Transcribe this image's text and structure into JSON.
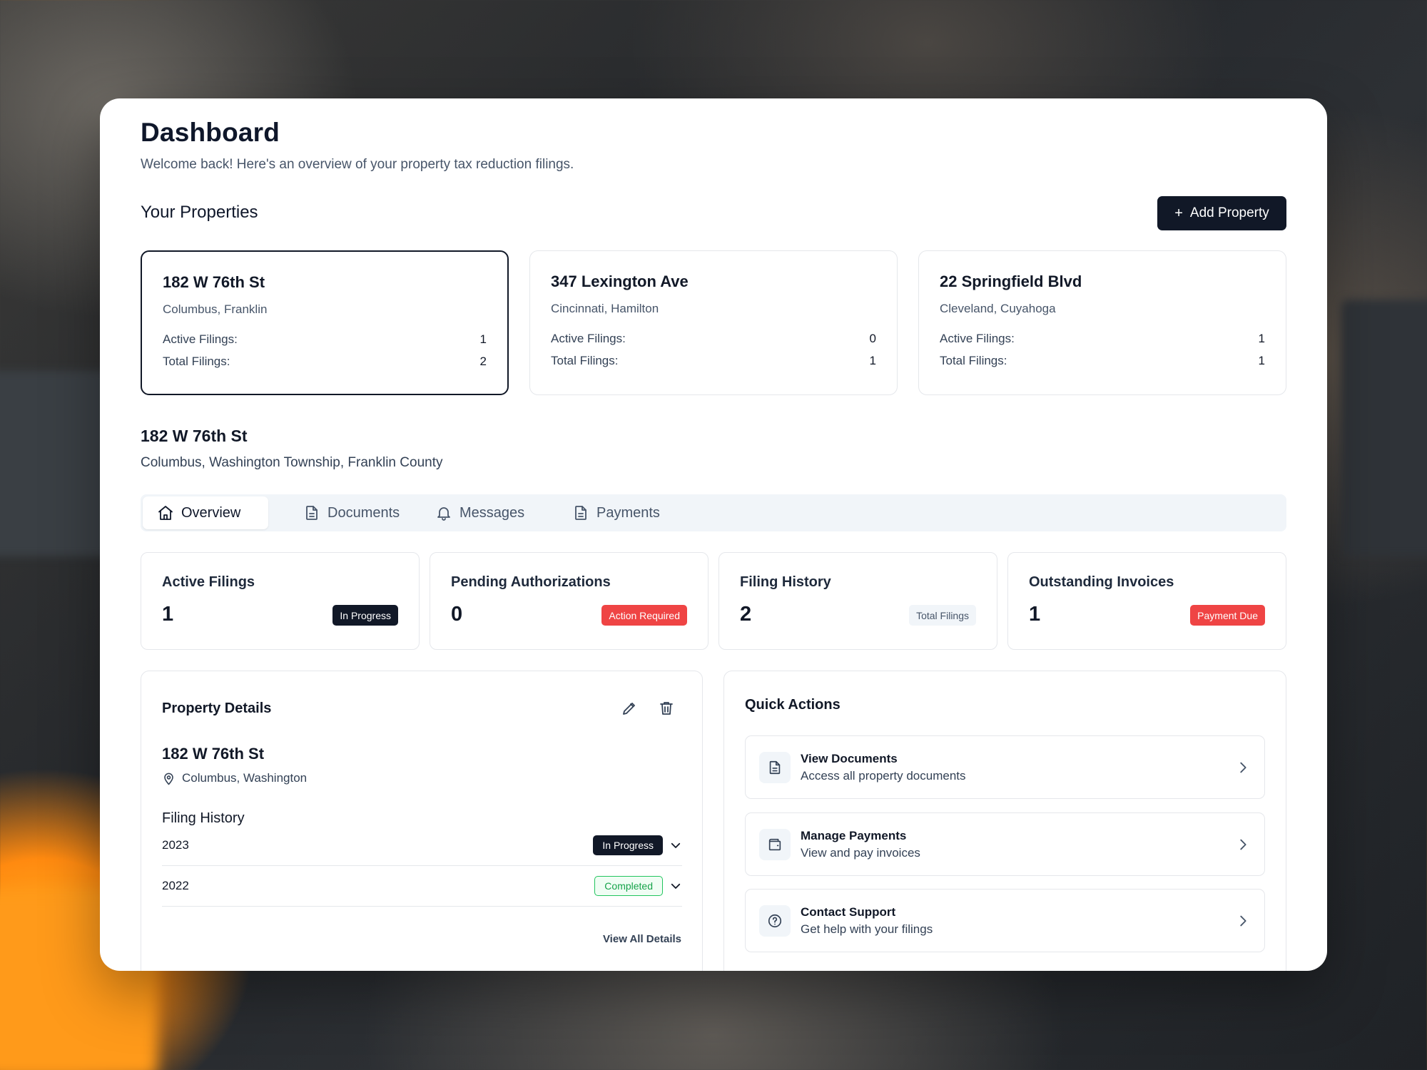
{
  "page": {
    "title": "Dashboard",
    "subtitle": "Welcome back! Here's an overview of your property tax reduction filings."
  },
  "properties_section": {
    "title": "Your Properties",
    "add_button": {
      "icon": "plus-icon",
      "label": "Add Property"
    }
  },
  "property_cards": [
    {
      "address": "182 W 76th St",
      "location": "Columbus, Franklin",
      "active_label": "Active Filings:",
      "active_value": "1",
      "total_label": "Total Filings:",
      "total_value": "2",
      "selected": true
    },
    {
      "address": "347 Lexington Ave",
      "location": "Cincinnati, Hamilton",
      "active_label": "Active Filings:",
      "active_value": "0",
      "total_label": "Total Filings:",
      "total_value": "1",
      "selected": false
    },
    {
      "address": "22 Springfield Blvd",
      "location": "Cleveland, Cuyahoga",
      "active_label": "Active Filings:",
      "active_value": "1",
      "total_label": "Total Filings:",
      "total_value": "1",
      "selected": false
    }
  ],
  "selected_property": {
    "address": "182 W 76th St",
    "location": "Columbus, Washington Township, Franklin County"
  },
  "tabs": [
    {
      "label": "Overview",
      "icon": "home-icon",
      "active": true
    },
    {
      "label": "Documents",
      "icon": "document-icon",
      "active": false
    },
    {
      "label": "Messages",
      "icon": "bell-icon",
      "active": false
    },
    {
      "label": "Payments",
      "icon": "document-icon",
      "active": false
    }
  ],
  "stats": [
    {
      "title": "Active Filings",
      "value": "1",
      "badge": "In Progress",
      "badge_color": "#111827"
    },
    {
      "title": "Pending Authorizations",
      "value": "0",
      "badge": "Action Required",
      "badge_color": "#ef4444"
    },
    {
      "title": "Filing History",
      "value": "2",
      "badge": "Total Filings",
      "badge_color": "#f1f5f9"
    },
    {
      "title": "Outstanding Invoices",
      "value": "1",
      "badge": "Payment Due",
      "badge_color": "#ef4444"
    }
  ],
  "property_details": {
    "title": "Property Details",
    "edit_icon": "pencil-icon",
    "delete_icon": "trash-icon",
    "address": "182 W 76th St",
    "location": "Columbus, Washington",
    "location_icon": "map-pin-icon",
    "filing_history_title": "Filing History",
    "filings": [
      {
        "year": "2023",
        "status": "In Progress",
        "status_color": "#111827"
      },
      {
        "year": "2022",
        "status": "Completed",
        "status_color": "#16a34a"
      }
    ],
    "view_all": "View All Details"
  },
  "quick_actions": {
    "title": "Quick Actions",
    "items": [
      {
        "name": "View Documents",
        "description": "Access all property documents",
        "icon": "document-icon"
      },
      {
        "name": "Manage Payments",
        "description": "View and pay invoices",
        "icon": "wallet-icon"
      },
      {
        "name": "Contact Support",
        "description": "Get help with your filings",
        "icon": "help-circle-icon"
      }
    ]
  }
}
